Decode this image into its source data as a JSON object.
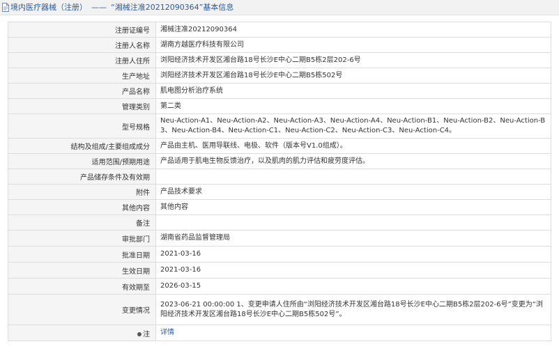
{
  "header": {
    "category": "境内医疗器械（注册）",
    "separator": "——",
    "title": "“湘械注准20212090364”基本信息"
  },
  "rows": [
    {
      "label": "注册证编号",
      "value": "湘械注准20212090364"
    },
    {
      "label": "注册人名称",
      "value": "湖南方越医疗科技有限公司"
    },
    {
      "label": "注册人住所",
      "value": "浏阳经济技术开发区湘台路18号长沙E中心二期B5栋2层202-6号"
    },
    {
      "label": "生产地址",
      "value": "浏阳经济技术开发区湘台路18号长沙E中心二期B5栋502号"
    },
    {
      "label": "产品名称",
      "value": "肌电图分析治疗系统"
    },
    {
      "label": "管理类别",
      "value": "第二类"
    },
    {
      "label": "型号规格",
      "value": "Neu-Action-A1、Neu-Action-A2、Neu-Action-A3、Neu-Action-A4、Neu-Action-B1、Neu-Action-B2、Neu-Action-B3、Neu-Action-B4、Neu-Action-C1、Neu-Action-C2、Neu-Action-C3、Neu-Action-C4。"
    },
    {
      "label": "结构及组成/主要组成成分",
      "value": "产品由主机、医用导联线、电极、软件（版本号V1.0组成）。"
    },
    {
      "label": "适用范围/预期用途",
      "value": "产品适用于肌电生物反馈治疗，以及肌肉的肌力评估和疲劳度评估。"
    },
    {
      "label": "产品储存条件及有效期",
      "value": ""
    },
    {
      "label": "附件",
      "value": "产品技术要求"
    },
    {
      "label": "其他内容",
      "value": "其他内容"
    },
    {
      "label": "备注",
      "value": ""
    },
    {
      "label": "审批部门",
      "value": "湖南省药品监督管理局"
    },
    {
      "label": "批准日期",
      "value": "2021-03-16"
    },
    {
      "label": "生效日期",
      "value": "2021-03-16"
    },
    {
      "label": "有效期至",
      "value": "2026-03-15"
    },
    {
      "label": "变更情况",
      "value": "2023-06-21 00:00:00 1、变更申请人住所由“浏阳经济技术开发区湘台路18号长沙E中心二期B5栋2层202-6号”变更为“浏阳经济技术开发区湘台路18号长沙E中心二期B5栋502号”。"
    }
  ],
  "note_row": {
    "label": "注",
    "link": "详情"
  },
  "icons": {
    "header": "document-icon",
    "note": "note-dot-icon"
  },
  "colors": {
    "header_text": "#2f5b96",
    "label_bg": "#f5f5f5",
    "border": "#dcdcdc",
    "link": "#2f5b96"
  }
}
